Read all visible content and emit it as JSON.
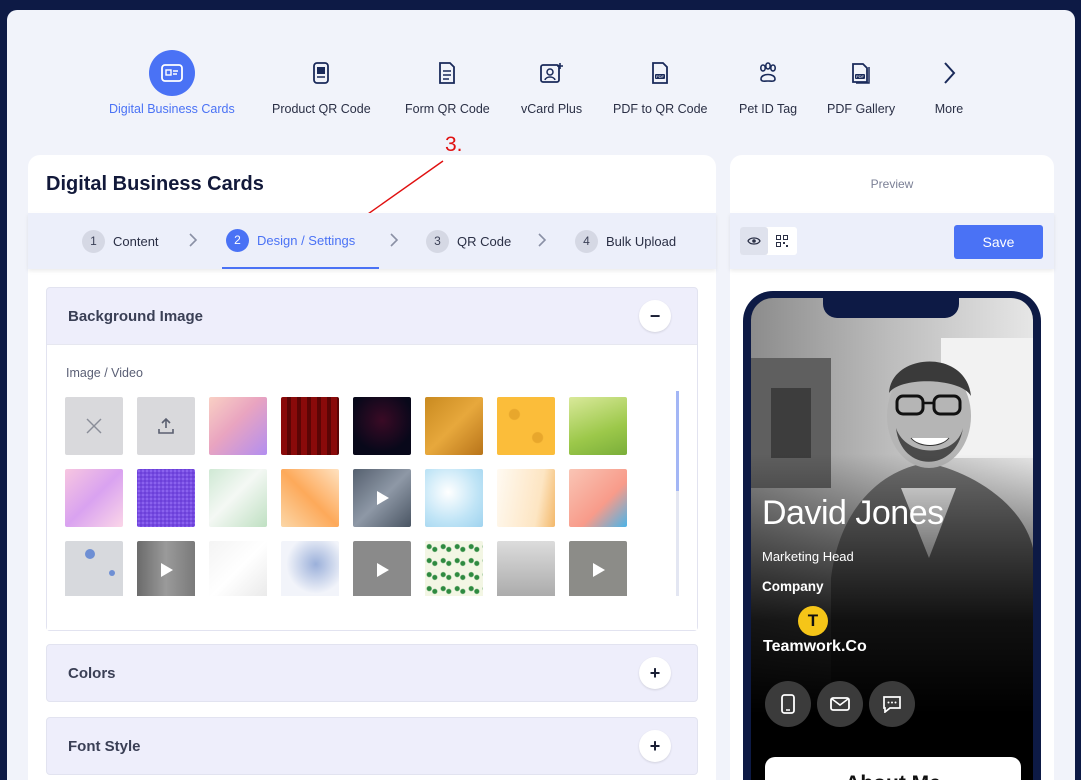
{
  "nav": {
    "items": [
      {
        "label": "Digital Business Cards",
        "icon": "id-card-icon",
        "active": true
      },
      {
        "label": "Product QR Code",
        "icon": "product-icon"
      },
      {
        "label": "Form QR Code",
        "icon": "form-icon"
      },
      {
        "label": "vCard Plus",
        "icon": "vcard-icon"
      },
      {
        "label": "PDF to QR Code",
        "icon": "pdf-icon"
      },
      {
        "label": "Pet ID Tag",
        "icon": "paw-icon"
      },
      {
        "label": "PDF Gallery",
        "icon": "pdf-gallery-icon"
      },
      {
        "label": "More",
        "icon": "chevron-right-icon"
      }
    ]
  },
  "panel": {
    "title": "Digital Business Cards",
    "annotation": "3.",
    "steps": [
      {
        "num": "1",
        "label": "Content"
      },
      {
        "num": "2",
        "label": "Design / Settings",
        "active": true
      },
      {
        "num": "3",
        "label": "QR Code"
      },
      {
        "num": "4",
        "label": "Bulk Upload"
      }
    ]
  },
  "sections": {
    "background": {
      "title": "Background Image",
      "toggle": "−",
      "sublabel": "Image / Video"
    },
    "colors": {
      "title": "Colors",
      "toggle": "+"
    },
    "font": {
      "title": "Font Style",
      "toggle": "+"
    }
  },
  "preview": {
    "label": "Preview",
    "save_label": "Save",
    "card": {
      "name": "David Jones",
      "title": "Marketing Head",
      "company_label": "Company",
      "logo_letter": "T",
      "company_name": "Teamwork.Co",
      "about_heading": "About Me"
    }
  },
  "colors": {
    "accent": "#4a72f5",
    "navy": "#0d1a45",
    "annotation": "#e01010"
  }
}
